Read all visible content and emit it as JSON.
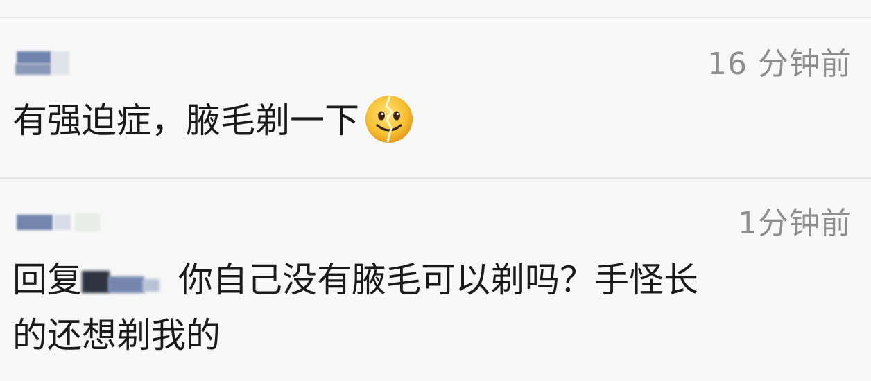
{
  "comments": [
    {
      "timestamp": "16 分钟前",
      "text": "有强迫症，腋毛剃一下",
      "emoji": "cracked-smile-emoji"
    },
    {
      "timestamp": "1分钟前",
      "reply_prefix": "回复",
      "reply_text_line1": "你自己没有腋毛可以剃吗？手怪长",
      "reply_text_line2": "的还想剃我的"
    }
  ],
  "colors": {
    "background": "#f8f8f8",
    "timestamp": "#8e8e8e",
    "text": "#1a1a1a",
    "divider": "#e6e6e6",
    "avatar_blur": "#6a7fa8"
  }
}
